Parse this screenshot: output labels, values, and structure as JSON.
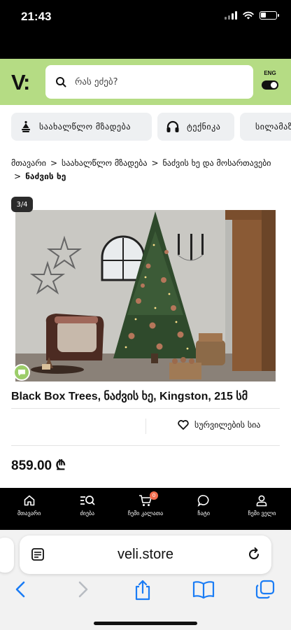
{
  "status_bar": {
    "time": "21:43"
  },
  "header": {
    "logo": "V:",
    "search_placeholder": "რას ეძებ?",
    "language": "ENG"
  },
  "categories": [
    {
      "label": "საახალწლო მზადება",
      "icon": "christmas-tree-icon"
    },
    {
      "label": "ტექნიკა",
      "icon": "headphones-icon"
    },
    {
      "label": "სილამაზე",
      "icon": "cosmetics-icon"
    }
  ],
  "breadcrumb": {
    "items": [
      "მთავარი",
      "საახალწლო მზადება",
      "ნაძვის ხე და მოსართავები"
    ],
    "current": "ნაძვის ხე"
  },
  "gallery": {
    "counter": "3/4"
  },
  "product": {
    "title": "Black Box Trees, ნაძვის ხე, Kingston, 215 სმ",
    "wishlist_label": "სურვილების სია",
    "price": "859.00 ₾"
  },
  "bottom_nav": {
    "items": [
      {
        "label": "მთავარი",
        "icon": "home-icon"
      },
      {
        "label": "ძიება",
        "icon": "search-list-icon"
      },
      {
        "label": "ჩემი კალათა",
        "icon": "cart-icon"
      },
      {
        "label": "ჩატი",
        "icon": "chat-icon"
      },
      {
        "label": "ჩემი ველი",
        "icon": "user-icon"
      }
    ],
    "cart_count": "0"
  },
  "browser": {
    "url": "veli.store"
  },
  "colors": {
    "header_green": "#b5dc84",
    "badge_orange": "#f26d4f",
    "safari_blue": "#1a7cf5"
  }
}
